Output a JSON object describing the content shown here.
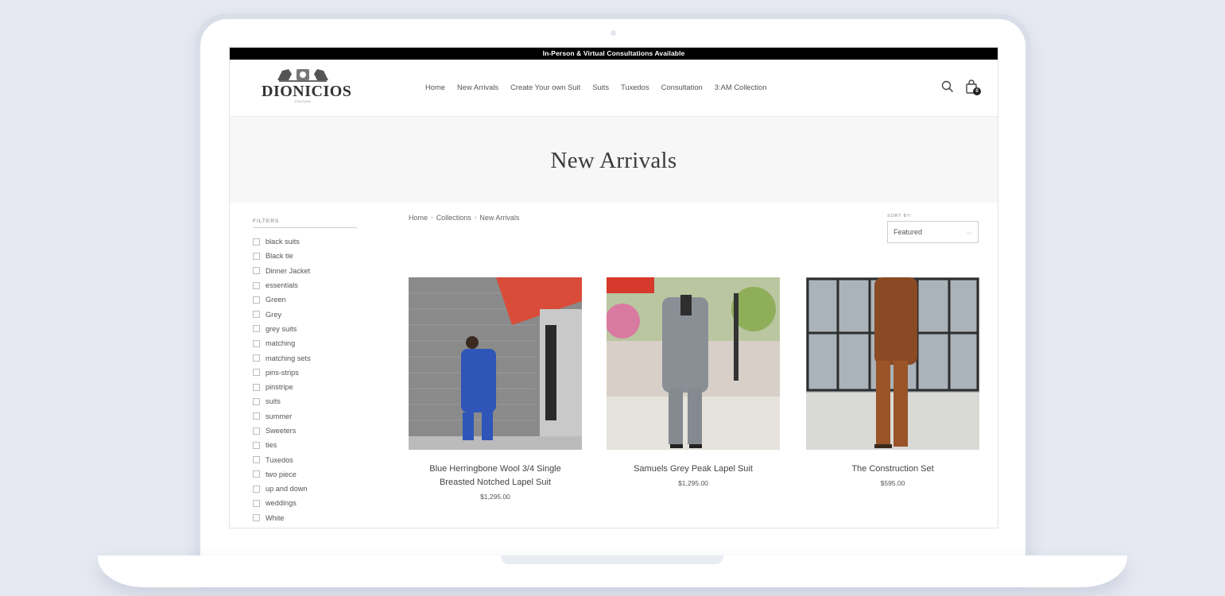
{
  "announcement": "In-Person & Virtual Consultations Available",
  "logo": {
    "name": "DIONICIOS",
    "subtitle": "COUTURE"
  },
  "nav": [
    "Home",
    "New Arrivals",
    "Create Your own Suit",
    "Suits",
    "Tuxedos",
    "Consultation",
    "3:AM Collection"
  ],
  "icons": {
    "search": "search-icon",
    "cart": "shopping-bag-icon"
  },
  "cart_count": "0",
  "page_title": "New Arrivals",
  "breadcrumb": [
    "Home",
    "Collections",
    "New Arrivals"
  ],
  "filters": {
    "title": "FILTERS",
    "items": [
      "black suits",
      "Black tie",
      "Dinner Jacket",
      "essentials",
      "Green",
      "Grey",
      "grey suits",
      "matching",
      "matching sets",
      "pins-strips",
      "pinstripe",
      "suits",
      "summer",
      "Sweeters",
      "ties",
      "Tuxedos",
      "two piece",
      "up and down",
      "weddings",
      "White"
    ]
  },
  "sort": {
    "label": "SORT BY:",
    "value": "Featured"
  },
  "products": [
    {
      "name_line1": "Blue Herringbone Wool 3/4 Single",
      "name_line2": "Breasted Notched Lapel Suit",
      "price": "$1,295.00"
    },
    {
      "name_line1": "Samuels Grey Peak Lapel Suit",
      "name_line2": "",
      "price": "$1,295.00"
    },
    {
      "name_line1": "The Construction Set",
      "name_line2": "",
      "price": "$595.00"
    }
  ],
  "colors": {
    "announcement_bg": "#000000",
    "hero_bg": "#f7f7f7",
    "page_bg": "#e6e9f1"
  }
}
